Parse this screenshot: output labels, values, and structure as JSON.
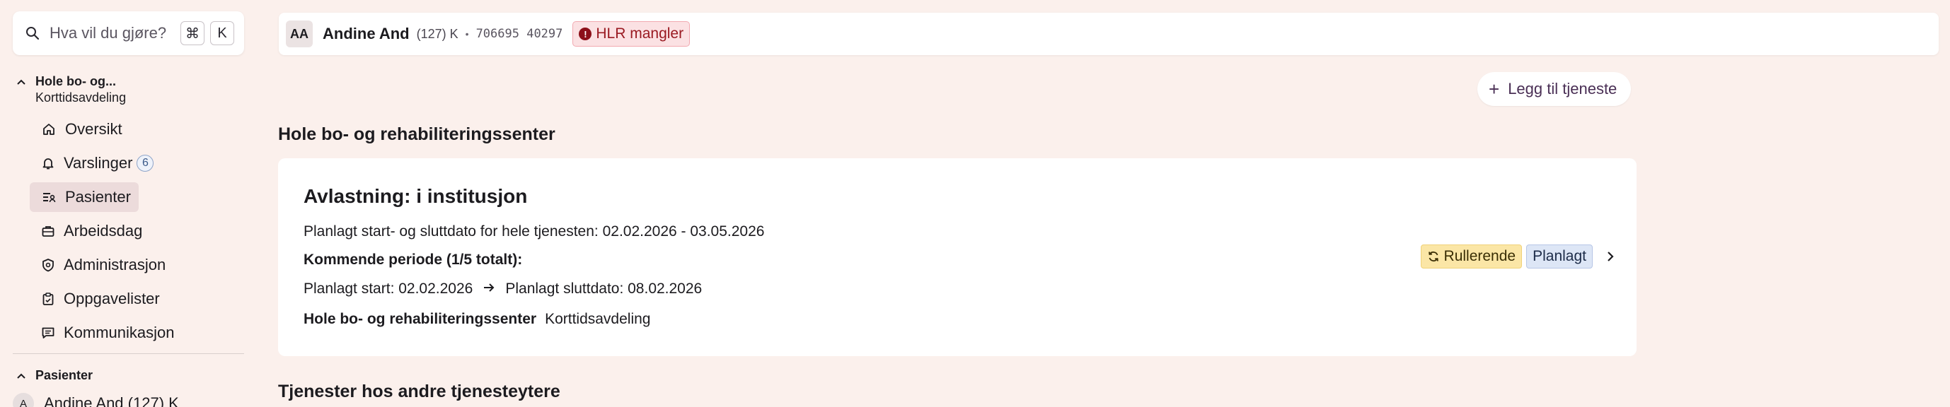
{
  "search": {
    "placeholder": "Hva vil du gjøre?",
    "key1": "⌘",
    "key2": "K"
  },
  "sidebar": {
    "group1": {
      "title": "Hole bo- og...",
      "subtitle": "Korttidsavdeling"
    },
    "items": [
      {
        "label": "Oversikt",
        "icon": "home-icon"
      },
      {
        "label": "Varslinger",
        "icon": "bell-icon",
        "badge": "6"
      },
      {
        "label": "Pasienter",
        "icon": "patient-list-icon",
        "active": true
      },
      {
        "label": "Arbeidsdag",
        "icon": "briefcase-icon"
      },
      {
        "label": "Administrasjon",
        "icon": "shield-gear-icon"
      },
      {
        "label": "Oppgavelister",
        "icon": "clipboard-icon"
      },
      {
        "label": "Kommunikasjon",
        "icon": "message-icon"
      }
    ],
    "group2": {
      "title": "Pasienter"
    },
    "patient_row": {
      "avatar": "A",
      "name": "Andine And (127) K"
    }
  },
  "topbar": {
    "avatar": "AA",
    "name": "Andine And",
    "meta": "(127) K",
    "separator": "•",
    "patient_id": "706695 40297",
    "alert": "HLR mangler"
  },
  "actions": {
    "add_service": "Legg til tjeneste"
  },
  "section1": {
    "title": "Hole bo- og rehabiliteringssenter"
  },
  "service_card": {
    "title": "Avlastning: i institusjon",
    "planned_range": "Planlagt start- og sluttdato for hele tjenesten: 02.02.2026 - 03.05.2026",
    "upcoming": "Kommende periode (1/5 totalt):",
    "start": "Planlagt start: 02.02.2026",
    "end": "Planlagt sluttdato: 08.02.2026",
    "location": "Hole bo- og rehabiliteringssenter",
    "unit": "Korttidsavdeling",
    "badge_rolling": "Rullerende",
    "badge_planned": "Planlagt"
  },
  "section2": {
    "title": "Tjenester hos andre tjenesteytere"
  },
  "colors": {
    "background": "#fbf0ec",
    "active_nav": "#ecdbdb",
    "alert_bg": "#fbe1e3",
    "rolling_bg": "#fbe6a6",
    "planned_bg": "#dde6f6"
  }
}
